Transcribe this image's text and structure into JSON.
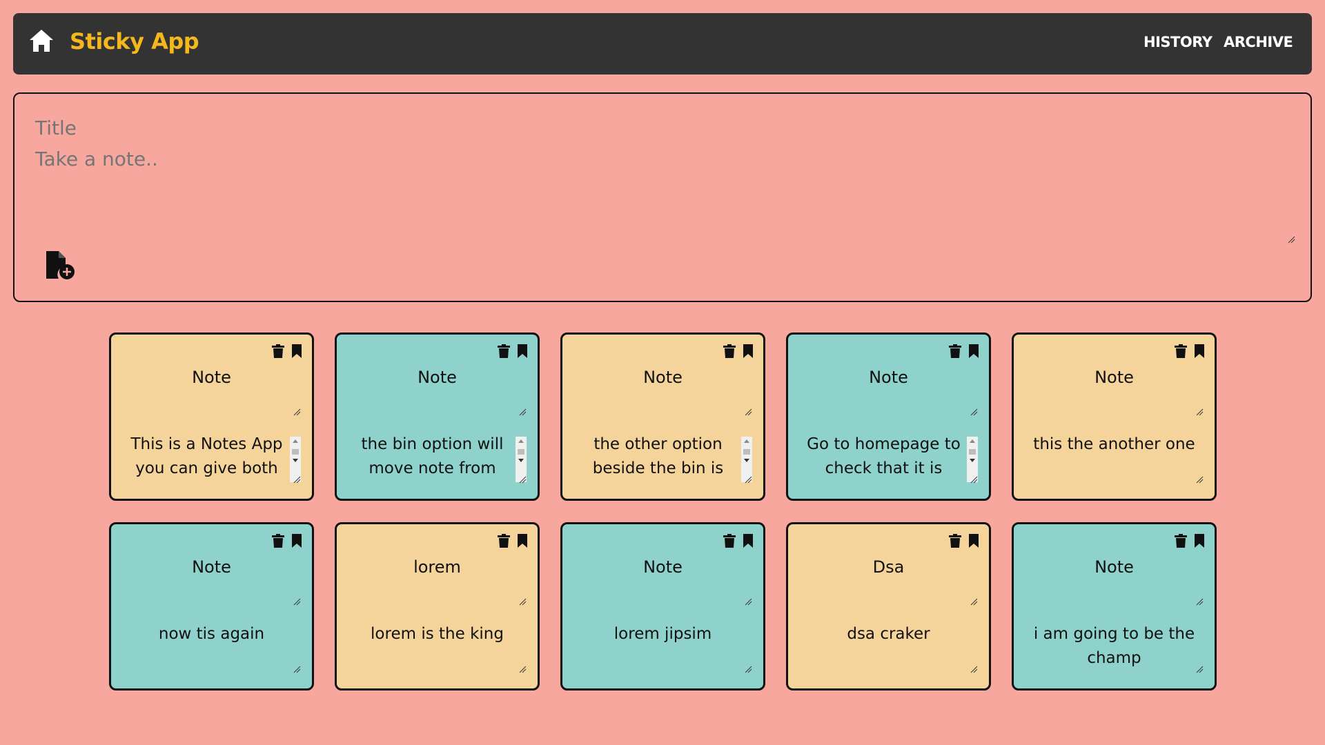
{
  "app": {
    "brand": "Sticky App",
    "nav": {
      "history": "HISTORY",
      "archive": "ARCHIVE"
    },
    "colors": {
      "background": "#f7a79e",
      "navbar": "#333333",
      "brand": "#f5b81c",
      "note_yellow": "#f4d49b",
      "note_teal": "#8ed2cb"
    }
  },
  "composer": {
    "title_placeholder": "Title",
    "body_placeholder": "Take a note.."
  },
  "notes": [
    {
      "title": "Note",
      "body": "This is a Notes App you can give both",
      "color": "yellow",
      "scrollbar": true
    },
    {
      "title": "Note",
      "body": "the bin option will move note from",
      "color": "teal",
      "scrollbar": true
    },
    {
      "title": "Note",
      "body": "the other option beside the bin is",
      "color": "yellow",
      "scrollbar": true
    },
    {
      "title": "Note",
      "body": "Go to homepage to check that it is",
      "color": "teal",
      "scrollbar": true
    },
    {
      "title": "Note",
      "body": "this the another one",
      "color": "yellow",
      "scrollbar": false
    },
    {
      "title": "Note",
      "body": "now tis again",
      "color": "teal",
      "scrollbar": false
    },
    {
      "title": "lorem",
      "body": "lorem is the king",
      "color": "yellow",
      "scrollbar": false
    },
    {
      "title": "Note",
      "body": "lorem  jipsim",
      "color": "teal",
      "scrollbar": false
    },
    {
      "title": "Dsa",
      "body": "dsa craker",
      "color": "yellow",
      "scrollbar": false
    },
    {
      "title": "Note",
      "body": "i am going to be the champ",
      "color": "teal",
      "scrollbar": false
    }
  ]
}
